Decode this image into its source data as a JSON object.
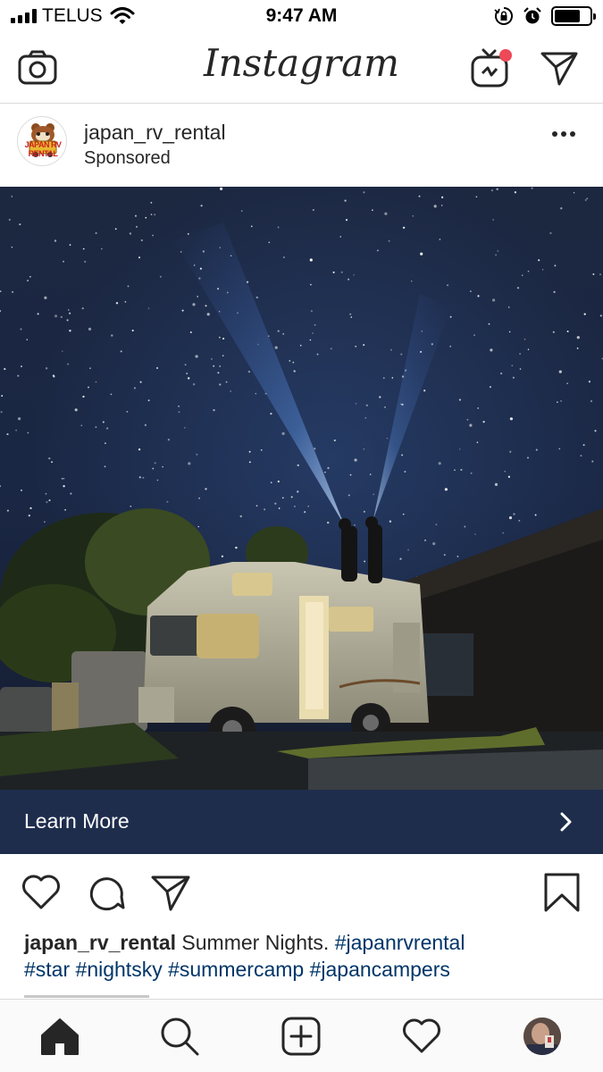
{
  "status_bar": {
    "carrier": "TELUS",
    "time": "9:47 AM",
    "battery_level": 0.74
  },
  "header": {
    "app_title": "Instagram",
    "icons": [
      "camera-icon",
      "igtv-icon",
      "direct-message-icon"
    ],
    "igtv_notification_color": "#ed4956"
  },
  "post": {
    "username": "japan_rv_rental",
    "subtitle": "Sponsored",
    "avatar_text": "JAPAN RV RENTAL",
    "cta_label": "Learn More",
    "cta_color": "#1f2d4d",
    "caption": {
      "user": "japan_rv_rental",
      "text": "Summer Nights.",
      "hashtags": [
        "#japanrvrental",
        "#star",
        "#nightsky",
        "#summercamp",
        "#japancampers"
      ]
    }
  },
  "tab_bar": {
    "items": [
      "home-icon",
      "search-icon",
      "add-post-icon",
      "activity-heart-icon",
      "profile-avatar"
    ]
  },
  "colors": {
    "hashtag": "#003569",
    "text": "#262626",
    "divider": "#dbdbdb"
  }
}
